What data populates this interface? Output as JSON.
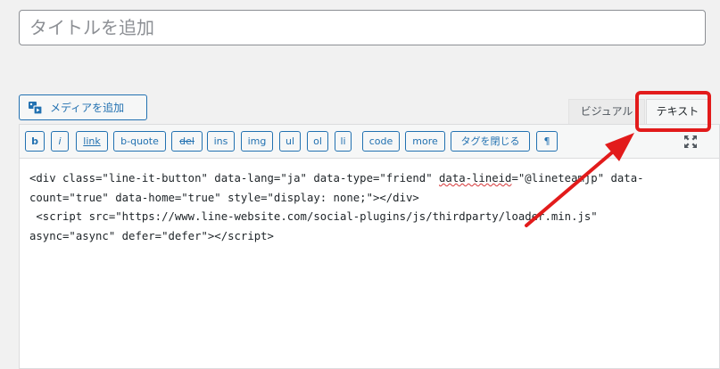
{
  "title_field": {
    "placeholder": "タイトルを追加"
  },
  "media_button": {
    "label": "メディアを追加",
    "icon": "media-icon"
  },
  "tabs": [
    {
      "label": "ビジュアル",
      "active": false
    },
    {
      "label": "テキスト",
      "active": true
    }
  ],
  "quicktags": [
    "b",
    "i",
    "link",
    "b-quote",
    "del",
    "ins",
    "img",
    "ul",
    "ol",
    "li",
    "code",
    "more",
    "タグを閉じる",
    "¶"
  ],
  "editor": {
    "lines": [
      "<div class=\"line-it-button\" data-lang=\"ja\" data-type=\"friend\" ",
      "data-lineid",
      "=\"@lineteamjp\" data-",
      "count=\"true\" data-home=\"true\" style=\"display: none;\"></div>",
      " <script src=\"https://www.line-website.com/social-plugins/js/thirdparty/loader.min.js\"",
      "async=\"async\" defer=\"defer\"></scr",
      "ipt>"
    ]
  },
  "colors": {
    "accent": "#2271b1",
    "highlight": "#e21b1b"
  }
}
